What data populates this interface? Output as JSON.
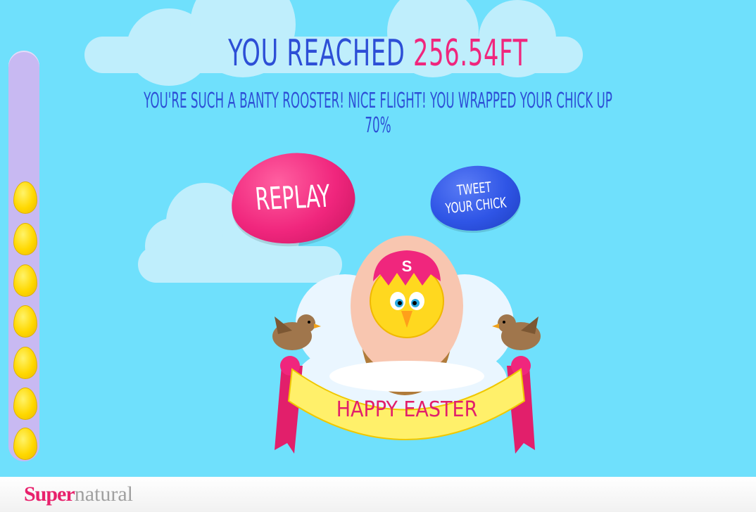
{
  "result": {
    "prefix": "YOU REACHED",
    "height_value": "256.54FT",
    "message": "YOU'RE SUCH A BANTY ROOSTER! NICE FLIGHT! YOU WRAPPED YOUR CHICK UP 70%"
  },
  "buttons": {
    "replay_label": "REPLAY",
    "tweet_line1": "TWEET",
    "tweet_line2": "YOUR CHICK"
  },
  "scene": {
    "egg_badge": "S",
    "banner_text": "HAPPY EASTER"
  },
  "progress": {
    "eggs_collected": 7
  },
  "footer": {
    "brand_strong": "Super",
    "brand_light": "natural"
  },
  "colors": {
    "sky": "#6fe0fc",
    "accent_pink": "#f0267d",
    "accent_blue": "#2d4fd6",
    "egg_yellow": "#ffd800"
  }
}
